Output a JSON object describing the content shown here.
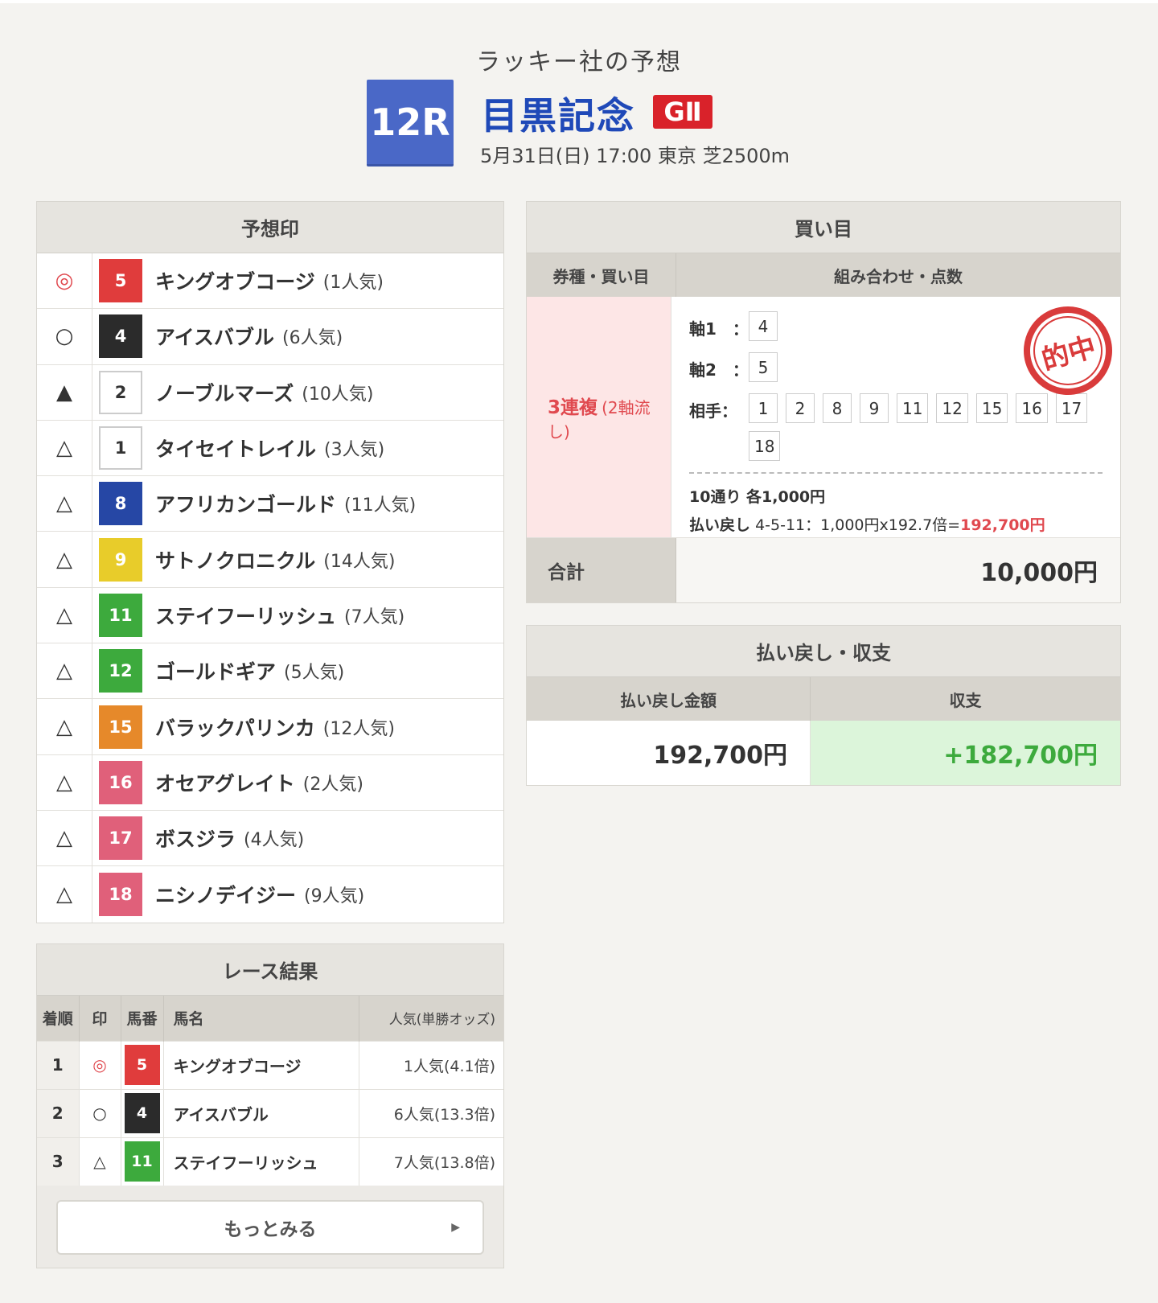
{
  "header": {
    "subtitle": "ラッキー社の予想",
    "race_number": "12R",
    "race_name": "目黒記念",
    "grade": "GⅡ",
    "info": "5月31日(日) 17:00 東京 芝2500m"
  },
  "prediction": {
    "title": "予想印",
    "rows": [
      {
        "mark": "◎",
        "num": "5",
        "name": "キングオブコージ",
        "pop": "(1人気)",
        "color": "#e03c3c"
      },
      {
        "mark": "○",
        "num": "4",
        "name": "アイスバブル",
        "pop": "(6人気)",
        "color": "#2b2b2b"
      },
      {
        "mark": "▲",
        "num": "2",
        "name": "ノーブルマーズ",
        "pop": "(10人気)",
        "color": "#ffffff"
      },
      {
        "mark": "△",
        "num": "1",
        "name": "タイセイトレイル",
        "pop": "(3人気)",
        "color": "#ffffff"
      },
      {
        "mark": "△",
        "num": "8",
        "name": "アフリカンゴールド",
        "pop": "(11人気)",
        "color": "#2647a5"
      },
      {
        "mark": "△",
        "num": "9",
        "name": "サトノクロニクル",
        "pop": "(14人気)",
        "color": "#e8cc2a"
      },
      {
        "mark": "△",
        "num": "11",
        "name": "ステイフーリッシュ",
        "pop": "(7人気)",
        "color": "#3daa3d"
      },
      {
        "mark": "△",
        "num": "12",
        "name": "ゴールドギア",
        "pop": "(5人気)",
        "color": "#3daa3d"
      },
      {
        "mark": "△",
        "num": "15",
        "name": "バラックパリンカ",
        "pop": "(12人気)",
        "color": "#e6892a"
      },
      {
        "mark": "△",
        "num": "16",
        "name": "オセアグレイト",
        "pop": "(2人気)",
        "color": "#e0607a"
      },
      {
        "mark": "△",
        "num": "17",
        "name": "ボスジラ",
        "pop": "(4人気)",
        "color": "#e0607a"
      },
      {
        "mark": "△",
        "num": "18",
        "name": "ニシノデイジー",
        "pop": "(9人気)",
        "color": "#e0607a"
      }
    ]
  },
  "result": {
    "title": "レース結果",
    "columns": {
      "rank": "着順",
      "mark": "印",
      "num": "馬番",
      "name": "馬名",
      "odds": "人気(単勝オッズ)"
    },
    "rows": [
      {
        "rank": "1",
        "mark": "◎",
        "num": "5",
        "name": "キングオブコージ",
        "odds": "1人気(4.1倍)",
        "color": "#e03c3c"
      },
      {
        "rank": "2",
        "mark": "○",
        "num": "4",
        "name": "アイスバブル",
        "odds": "6人気(13.3倍)",
        "color": "#2b2b2b"
      },
      {
        "rank": "3",
        "mark": "△",
        "num": "11",
        "name": "ステイフーリッシュ",
        "odds": "7人気(13.8倍)",
        "color": "#3daa3d"
      }
    ],
    "more_label": "もっとみる",
    "more_arrow": "▶"
  },
  "buy": {
    "title": "買い目",
    "col_type": "券種・買い目",
    "col_combo": "組み合わせ・点数",
    "bet_type": "3連複",
    "bet_sub": "(2軸流し)",
    "axis1_label": "軸1　：",
    "axis1": [
      "4"
    ],
    "axis2_label": "軸2　：",
    "axis2": [
      "5"
    ],
    "partner_label": "相手：",
    "partners": [
      "1",
      "2",
      "8",
      "9",
      "11",
      "12",
      "15",
      "16",
      "17",
      "18"
    ],
    "count_line": "10通り 各1,000円",
    "payout_label": "払い戻し",
    "payout_detail": "4-5-11：1,000円x192.7倍=",
    "payout_amount": "192,700円",
    "stamp": "的中",
    "total_label": "合計",
    "total_value": "10,000円"
  },
  "payout": {
    "title": "払い戻し・収支",
    "col_amount": "払い戻し金額",
    "col_balance": "収支",
    "amount": "192,700円",
    "balance": "+182,700円"
  }
}
